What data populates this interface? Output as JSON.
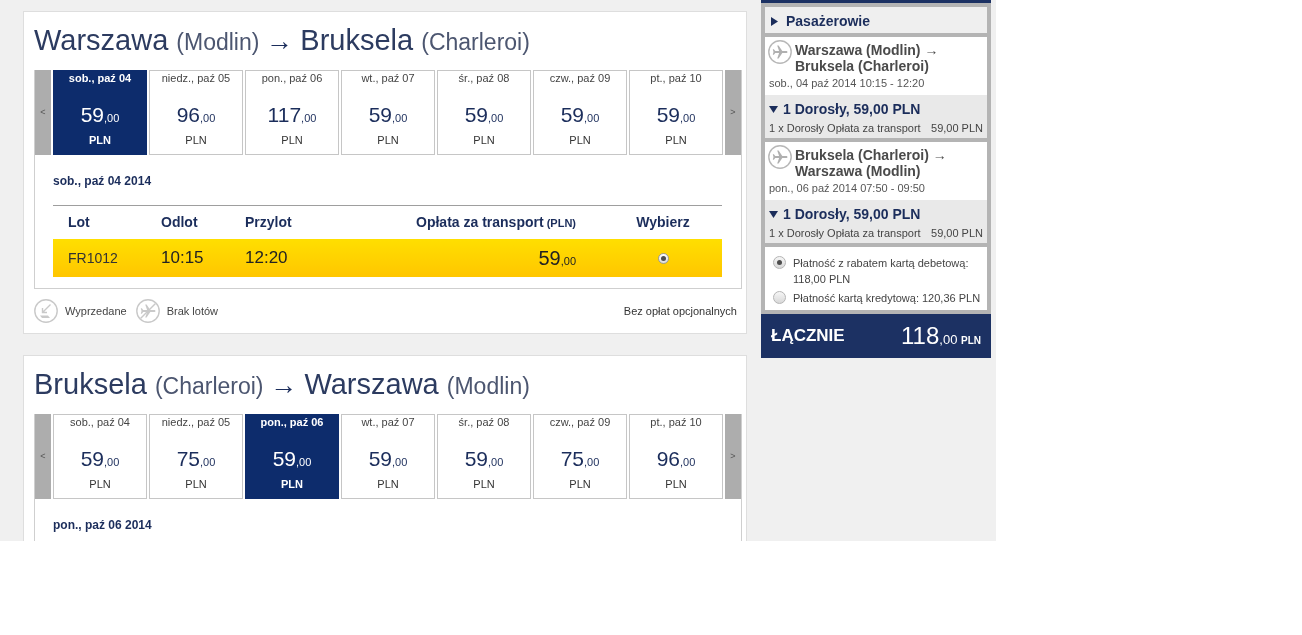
{
  "flights": [
    {
      "title": {
        "origin": "Warszawa",
        "origin_airport": "(Modlin)",
        "arrow": "→",
        "destination": "Bruksela",
        "destination_airport": "(Charleroi)"
      },
      "prev_button": "<",
      "next_button": ">",
      "days": [
        {
          "label": "sob., paź 04",
          "price": "59",
          "cents": ",00",
          "currency": "PLN",
          "selected": true
        },
        {
          "label": "niedz., paź 05",
          "price": "96",
          "cents": ",00",
          "currency": "PLN",
          "selected": false
        },
        {
          "label": "pon., paź 06",
          "price": "117",
          "cents": ",00",
          "currency": "PLN",
          "selected": false
        },
        {
          "label": "wt., paź 07",
          "price": "59",
          "cents": ",00",
          "currency": "PLN",
          "selected": false
        },
        {
          "label": "śr., paź 08",
          "price": "59",
          "cents": ",00",
          "currency": "PLN",
          "selected": false
        },
        {
          "label": "czw., paź 09",
          "price": "59",
          "cents": ",00",
          "currency": "PLN",
          "selected": false
        },
        {
          "label": "pt., paź 10",
          "price": "59",
          "cents": ",00",
          "currency": "PLN",
          "selected": false
        }
      ],
      "date": "sob., paź 04 2014",
      "table": {
        "columns": [
          {
            "label": "Lot"
          },
          {
            "label": "Odlot"
          },
          {
            "label": "Przylot"
          },
          {
            "label": "Opłata za transport",
            "unit": "(PLN)"
          },
          {
            "label": "Wybierz"
          }
        ],
        "rows": [
          {
            "flight": "FR1012",
            "departure": "10:15",
            "arrival": "12:20",
            "price": "59",
            "cents": ",00",
            "selected": true
          }
        ]
      },
      "legend": [
        {
          "kind": "sold_out",
          "label": "Wyprzedane"
        },
        {
          "kind": "no_flights",
          "label": "Brak lotów"
        }
      ],
      "note": "Bez opłat opcjonalnych"
    },
    {
      "title": {
        "origin": "Bruksela",
        "origin_airport": "(Charleroi)",
        "arrow": "→",
        "destination": "Warszawa",
        "destination_airport": "(Modlin)"
      },
      "prev_button": "<",
      "next_button": ">",
      "days": [
        {
          "label": "sob., paź 04",
          "price": "59",
          "cents": ",00",
          "currency": "PLN",
          "selected": false
        },
        {
          "label": "niedz., paź 05",
          "price": "75",
          "cents": ",00",
          "currency": "PLN",
          "selected": false
        },
        {
          "label": "pon., paź 06",
          "price": "59",
          "cents": ",00",
          "currency": "PLN",
          "selected": true
        },
        {
          "label": "wt., paź 07",
          "price": "59",
          "cents": ",00",
          "currency": "PLN",
          "selected": false
        },
        {
          "label": "śr., paź 08",
          "price": "59",
          "cents": ",00",
          "currency": "PLN",
          "selected": false
        },
        {
          "label": "czw., paź 09",
          "price": "75",
          "cents": ",00",
          "currency": "PLN",
          "selected": false
        },
        {
          "label": "pt., paź 10",
          "price": "96",
          "cents": ",00",
          "currency": "PLN",
          "selected": false
        }
      ],
      "date": "pon., paź 06 2014"
    }
  ],
  "sidebar": {
    "passengers": {
      "label": "Pasażerowie",
      "expanded": false
    },
    "trips": [
      {
        "route": "Warszawa (Modlin) → Bruksela (Charleroi)",
        "schedule": "sob., 04 paź 2014 10:15 - 12:20",
        "fare": {
          "summary": "1 Dorosły, 59,00 PLN",
          "expanded": true,
          "items": [
            {
              "label": "1 x Dorosły Opłata za transport",
              "amount": "59,00 PLN"
            }
          ]
        }
      },
      {
        "route": "Bruksela (Charleroi) → Warszawa (Modlin)",
        "schedule": "pon., 06 paź 2014 07:50 - 09:50",
        "fare": {
          "summary": "1 Dorosły, 59,00 PLN",
          "expanded": true,
          "items": [
            {
              "label": "1 x Dorosły Opłata za transport",
              "amount": "59,00 PLN"
            }
          ]
        }
      }
    ],
    "payment_options": [
      {
        "label": "Płatność z rabatem kartą debetową: 118,00 PLN",
        "selected": true
      },
      {
        "label": "Płatność kartą kredytową: 120,36 PLN",
        "selected": false
      }
    ],
    "total": {
      "label": "ŁĄCZNIE",
      "amount": "118",
      "cents": ",00",
      "currency": "PLN"
    }
  }
}
